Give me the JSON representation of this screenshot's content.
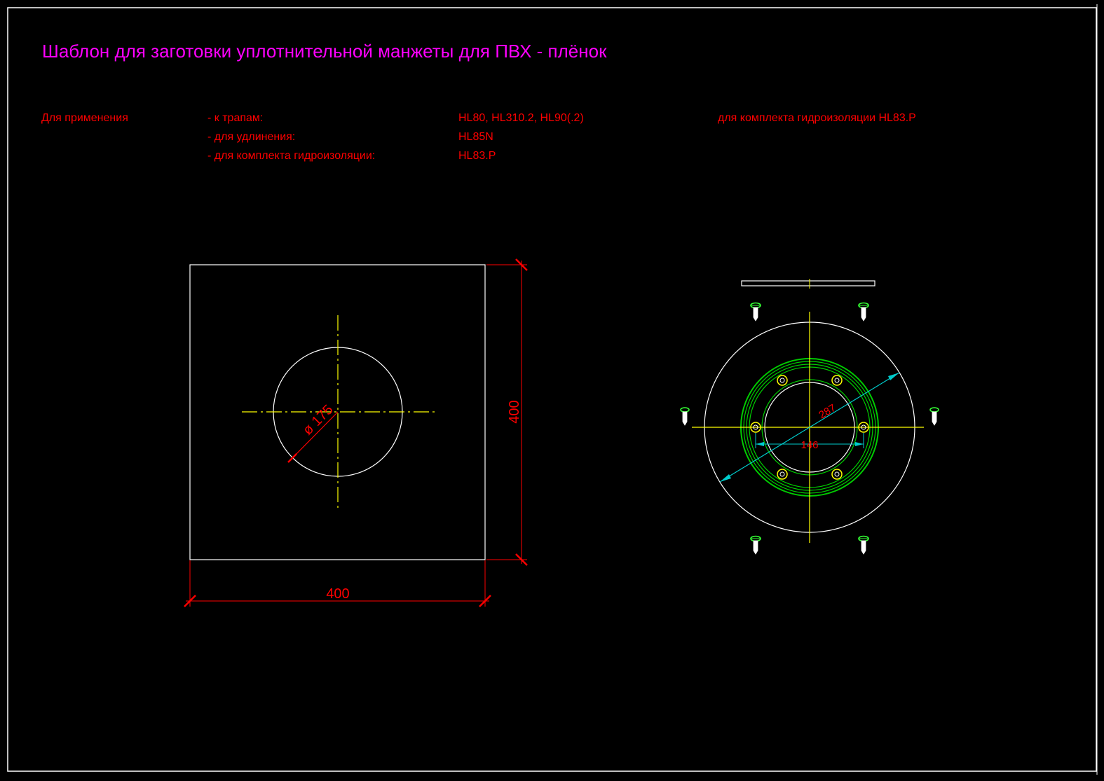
{
  "title": "Шаблон для заготовки уплотнительной манжеты для ПВХ - плёнок",
  "application": {
    "label": "Для применения",
    "rows": [
      {
        "label": "- к трапам:",
        "value": "HL80, HL310.2, HL90(.2)"
      },
      {
        "label": "- для удлинения:",
        "value": "HL85N"
      },
      {
        "label": "- для комплекта гидроизоляции:",
        "value": "HL83.P"
      }
    ],
    "note": "для комплекта гидроизоляции HL83.P"
  },
  "template_view": {
    "width_label": "400",
    "height_label": "400",
    "hole_diameter_label": "ø 175"
  },
  "flange_view": {
    "outer_diameter_label": "287",
    "bolt_spacing_label": "146"
  },
  "colors": {
    "background": "#000000",
    "outline": "#ffffff",
    "title": "#ff00ff",
    "text": "#ff0000",
    "dimension": "#ff0000",
    "centerline": "#ffff00",
    "flange": "#00cc00",
    "dimension_alt": "#00cccc",
    "screw": "#33ff33"
  }
}
